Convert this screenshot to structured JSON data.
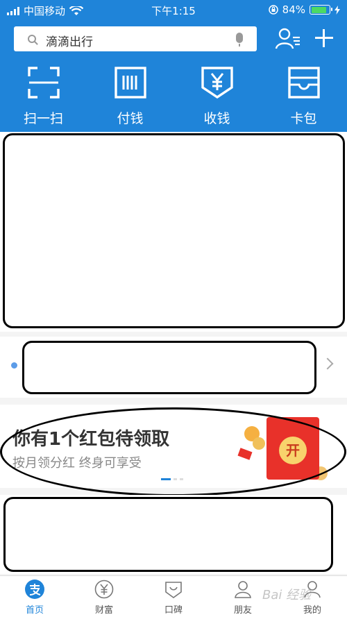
{
  "status_bar": {
    "carrier": "中国移动",
    "time": "下午1:15",
    "battery": "84%",
    "battery_level": 0.84
  },
  "search": {
    "placeholder": "滴滴出行"
  },
  "quick_actions": [
    {
      "label": "扫一扫",
      "icon": "scan-icon"
    },
    {
      "label": "付钱",
      "icon": "pay-barcode-icon"
    },
    {
      "label": "收钱",
      "icon": "receive-yuan-icon"
    },
    {
      "label": "卡包",
      "icon": "card-wallet-icon"
    }
  ],
  "banner": {
    "title": "你有1个红包待领取",
    "subtitle": "按月领分红 终身可享受",
    "envelope_text": "开"
  },
  "tab_bar": [
    {
      "label": "首页",
      "icon": "alipay-home-icon",
      "active": true
    },
    {
      "label": "财富",
      "icon": "wealth-yuan-icon",
      "active": false
    },
    {
      "label": "口碑",
      "icon": "koubei-icon",
      "active": false
    },
    {
      "label": "朋友",
      "icon": "friends-icon",
      "active": false
    },
    {
      "label": "我的",
      "icon": "me-icon",
      "active": false
    }
  ],
  "watermark": "Bai 经验",
  "colors": {
    "brand_blue": "#1f84d9",
    "red_envelope": "#e8312a",
    "battery_green": "#4cd964"
  }
}
